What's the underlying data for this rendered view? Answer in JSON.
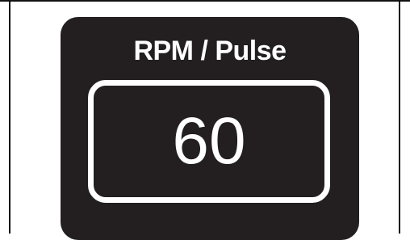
{
  "display": {
    "title": "RPM / Pulse",
    "value": "60"
  },
  "colors": {
    "panel_background": "#231f20",
    "text": "#ffffff",
    "frame_lines": "#111111"
  }
}
